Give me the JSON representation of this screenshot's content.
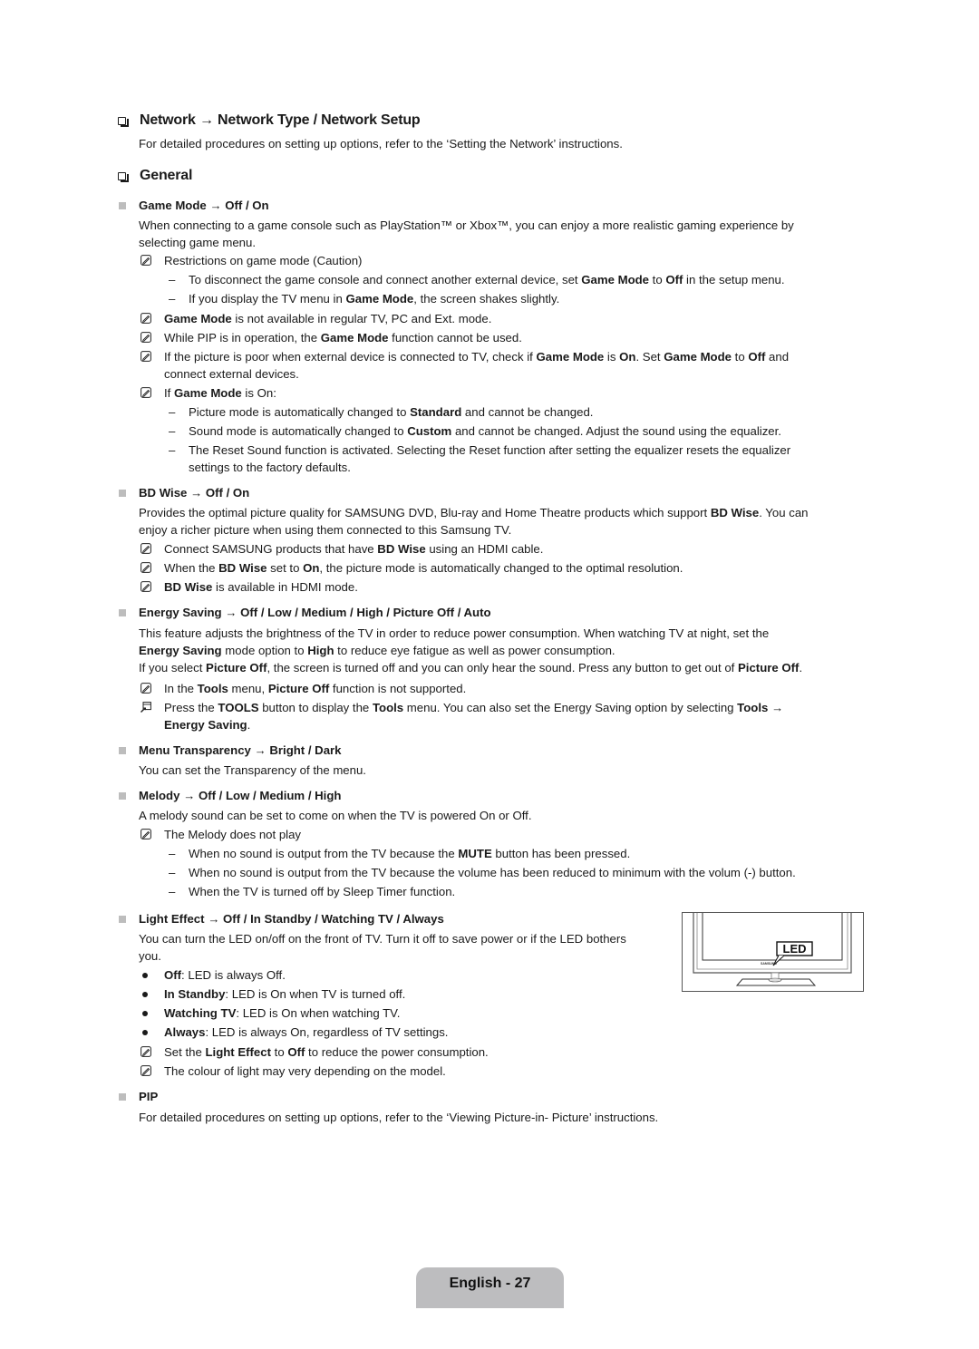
{
  "sections": {
    "network": {
      "title": "Network → Network Type / Network Setup",
      "text": "For detailed procedures on setting up options, refer to the ‘Setting the Network’ instructions."
    },
    "general": {
      "title": "General"
    }
  },
  "game_mode": {
    "heading": "Game Mode → Off / On",
    "p1": "When connecting to a game console such as PlayStation™ or Xbox™, you can enjoy a more realistic gaming experience by",
    "p2": "selecting game menu.",
    "n1": "Restrictions on game mode (Caution)",
    "d1": [
      "To disconnect the game console and connect another external device, set ",
      "Game Mode",
      " to ",
      "Off",
      " in the setup menu."
    ],
    "d2": [
      "If you display the TV menu in ",
      "Game Mode",
      ", the screen shakes slightly."
    ],
    "n2": [
      "Game Mode",
      " is not available in regular TV, PC and Ext. mode."
    ],
    "n3": [
      "While PIP is in operation, the ",
      "Game Mode",
      " function cannot be used."
    ],
    "n4a": [
      "If the picture is poor when external device is connected to TV, check if ",
      "Game Mode",
      " is ",
      "On",
      ". Set ",
      "Game Mode",
      " to ",
      "Off",
      " and"
    ],
    "n4b": "connect external devices.",
    "n5": [
      "If ",
      "Game Mode",
      " is On:"
    ],
    "d3": [
      "Picture mode is automatically changed to ",
      "Standard",
      " and cannot be changed."
    ],
    "d4": [
      "Sound mode is automatically changed to ",
      "Custom",
      " and cannot be changed. Adjust the sound using the equalizer."
    ],
    "d5a": "The Reset Sound function is activated. Selecting the Reset function after setting the equalizer resets the equalizer",
    "d5b": "settings to the factory defaults."
  },
  "bd_wise": {
    "heading": "BD Wise → Off / On",
    "p1": [
      "Provides the optimal picture quality for SAMSUNG DVD, Blu-ray and Home Theatre products which support ",
      "BD Wise",
      ". You can"
    ],
    "p2": "enjoy a richer picture when using them connected to this Samsung TV.",
    "n1": [
      "Connect SAMSUNG products that have ",
      "BD Wise",
      " using an HDMI cable."
    ],
    "n2": [
      "When the ",
      "BD Wise",
      " set to ",
      "On",
      ", the picture mode is automatically changed to the optimal resolution."
    ],
    "n3": [
      "BD Wise",
      " is available in HDMI mode."
    ]
  },
  "energy_saving": {
    "heading": "Energy Saving → Off / Low / Medium / High / Picture Off / Auto",
    "p1": "This feature adjusts the brightness of the TV in order to reduce power consumption. When watching TV at night, set the",
    "p2": [
      "Energy Saving",
      " mode option to ",
      "High",
      " to reduce eye fatigue as well as power consumption."
    ],
    "p3": [
      "If you select ",
      "Picture Off",
      ", the screen is turned off and you can only hear the sound. Press any button to get out of ",
      "Picture Off",
      "."
    ],
    "n1": [
      "In the ",
      "Tools",
      " menu, ",
      "Picture Off",
      " function is not supported."
    ],
    "t1": [
      "Press the ",
      "TOOLS",
      " button to display the ",
      "Tools",
      " menu. You can also set the Energy Saving option by selecting ",
      "Tools →"
    ],
    "t2": [
      "Energy Saving",
      "."
    ]
  },
  "menu_transparency": {
    "heading": "Menu Transparency → Bright / Dark",
    "p1": "You can set the Transparency of the menu."
  },
  "melody": {
    "heading": "Melody → Off / Low / Medium / High",
    "p1": "A melody sound can be set to come on when the TV is powered On or Off.",
    "n1": "The Melody does not play",
    "d1": [
      "When no sound is output from the TV because the ",
      "MUTE",
      " button has been pressed."
    ],
    "d2": "When no sound is output from the TV because the volume has been reduced to minimum with the volum (-) button.",
    "d3": "When the TV is turned off by Sleep Timer function."
  },
  "light_effect": {
    "heading": "Light Effect → Off / In Standby / Watching TV / Always",
    "p1": "You can turn the LED on/off on the front of TV. Turn it off to save power or if the LED bothers",
    "p2": "you.",
    "b1": [
      "Off",
      ": LED is always Off."
    ],
    "b2": [
      "In Standby",
      ": LED is On when TV is turned off."
    ],
    "b3": [
      "Watching TV",
      ": LED is On when watching TV."
    ],
    "b4": [
      "Always",
      ": LED is always On, regardless of TV settings."
    ],
    "n1": [
      "Set the ",
      "Light Effect",
      " to ",
      "Off",
      " to reduce the power consumption."
    ],
    "n2": "The colour of light may very depending on the model.",
    "figure": {
      "led_label": "LED",
      "brand_label": "SAMSUNG"
    }
  },
  "pip": {
    "heading": "PIP",
    "p1": "For detailed procedures on setting up options, refer to the ‘Viewing Picture-in- Picture’ instructions."
  },
  "footer": {
    "page_label": "English - 27"
  },
  "symbols": {
    "dash": "–"
  }
}
